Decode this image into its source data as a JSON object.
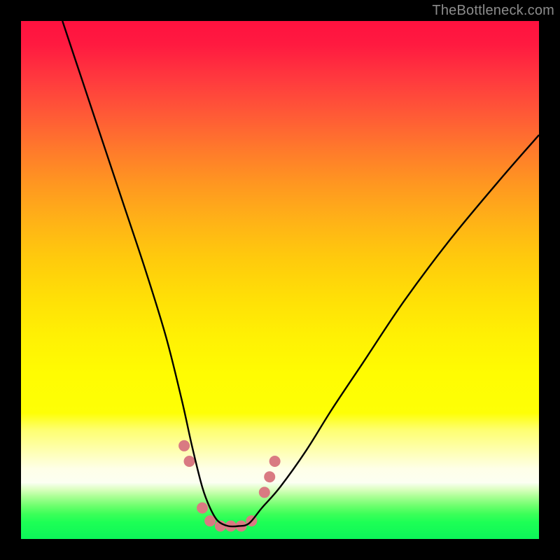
{
  "watermark": "TheBottleneck.com",
  "chart_data": {
    "type": "line",
    "title": "",
    "xlabel": "",
    "ylabel": "",
    "xlim": [
      0,
      100
    ],
    "ylim": [
      0,
      100
    ],
    "background_gradient_stops": [
      {
        "pos": 0,
        "color": "#ff113f"
      },
      {
        "pos": 35,
        "color": "#ff8a24"
      },
      {
        "pos": 70,
        "color": "#fff004"
      },
      {
        "pos": 82,
        "color": "#feffbe"
      },
      {
        "pos": 88,
        "color": "#fdfff0"
      },
      {
        "pos": 100,
        "color": "#0cf659"
      }
    ],
    "series": [
      {
        "name": "bottleneck-curve",
        "color": "#000000",
        "x": [
          8,
          12,
          16,
          20,
          24,
          28,
          31,
          33,
          35,
          36.5,
          38,
          40,
          42,
          44,
          46.5,
          50,
          55,
          60,
          66,
          74,
          83,
          93,
          100
        ],
        "y": [
          100,
          88,
          76,
          64,
          52,
          39,
          27,
          18,
          10,
          6,
          3.5,
          2.5,
          2.5,
          3,
          6,
          10,
          17,
          25,
          34,
          46,
          58,
          70,
          78
        ]
      }
    ],
    "markers": {
      "name": "highlight-dots",
      "color": "#d97a82",
      "radius_px": 8,
      "points": [
        {
          "x": 31.5,
          "y": 18
        },
        {
          "x": 32.5,
          "y": 15
        },
        {
          "x": 35.0,
          "y": 6
        },
        {
          "x": 36.5,
          "y": 3.5
        },
        {
          "x": 38.5,
          "y": 2.5
        },
        {
          "x": 40.5,
          "y": 2.5
        },
        {
          "x": 42.5,
          "y": 2.5
        },
        {
          "x": 44.5,
          "y": 3.5
        },
        {
          "x": 47.0,
          "y": 9
        },
        {
          "x": 48.0,
          "y": 12
        },
        {
          "x": 49.0,
          "y": 15
        }
      ]
    }
  }
}
